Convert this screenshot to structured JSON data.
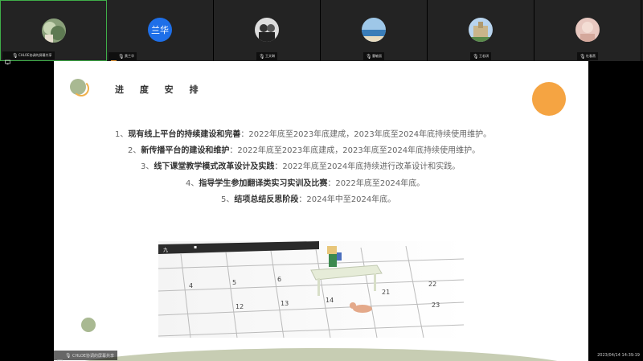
{
  "participants": [
    {
      "name": "CHLOE协调的屏幕共享",
      "avatar": "photo-plants",
      "active": true
    },
    {
      "name": "黄兰华",
      "avatar_text": "兰华",
      "avatar_color": "#1e6fe8"
    },
    {
      "name": "王文琳",
      "avatar": "photo-people"
    },
    {
      "name": "曹敏丽",
      "avatar": "photo-sea"
    },
    {
      "name": "王若琪",
      "avatar": "photo-castle"
    },
    {
      "name": "杜春燕",
      "avatar": "photo-person"
    }
  ],
  "slide": {
    "title": "进 度 安 排",
    "items": [
      {
        "num": "1、",
        "bold": "现有线上平台的持续建设和完善",
        "text": "：2022年底至2023年底建成，2023年底至2024年底持续使用维护。"
      },
      {
        "num": "2、",
        "bold": "新传播平台的建设和维护",
        "text": "：2022年底至2023年底建成，2023年底至2024年底持续使用维护。"
      },
      {
        "num": "3、",
        "bold": "线下课堂教学模式改革设计及实践",
        "text": "：2022年底至2024年底持续进行改革设计和实践。"
      },
      {
        "num": "4、",
        "bold": "指导学生参加翻译类实习实训及比赛",
        "text": "：2022年底至2024年底。"
      },
      {
        "num": "5、",
        "bold": "结项总结反思阶段",
        "text": "：2024年中至2024年底。"
      }
    ],
    "calendar_numbers": [
      "4",
      "5",
      "6",
      "12",
      "13",
      "14",
      "21",
      "22",
      "23"
    ]
  },
  "bottom_bar": {
    "label": "CHLOE协调的屏幕共享"
  },
  "timestamp": "2023/04/14 14:39:19",
  "colors": {
    "orange": "#f5a442",
    "sage": "#a9b992",
    "active_border": "#3fae49"
  }
}
